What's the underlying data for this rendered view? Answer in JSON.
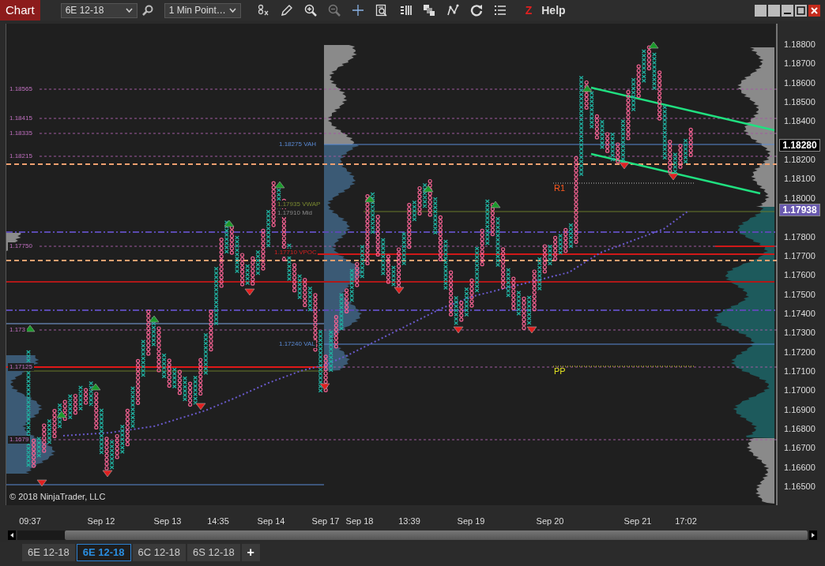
{
  "toolbar": {
    "app_button": "Chart",
    "instrument": "6E 12-18",
    "interval": "1 Min Point…",
    "badge": "Z",
    "help": "Help"
  },
  "price_axis": {
    "labels": [
      "1.18800",
      "1.18700",
      "1.18600",
      "1.18500",
      "1.18400",
      "1.18200",
      "1.18100",
      "1.18000",
      "1.17800",
      "1.17700",
      "1.17600",
      "1.17500",
      "1.17400",
      "1.17300",
      "1.17200",
      "1.17100",
      "1.17000",
      "1.16900",
      "1.16800",
      "1.16700",
      "1.16600",
      "1.16500"
    ],
    "markers": [
      {
        "text": "1.18280",
        "kind": "last"
      },
      {
        "text": "1.17938",
        "kind": "vwap"
      }
    ]
  },
  "level_labels": [
    "1.18565",
    "1.18415",
    "1.18335",
    "1.18215",
    "1.17750",
    "1.173",
    "1.17125",
    "1.1679"
  ],
  "study_labels": [
    {
      "text": "1.18275 VAH",
      "kind": "value-area"
    },
    {
      "text": "1.17935 VWAP",
      "kind": "vwap"
    },
    {
      "text": "1.17910 Mid",
      "kind": "mid"
    },
    {
      "text": "1.17710 VPOC",
      "kind": "poc"
    },
    {
      "text": "1.17240 VAL",
      "kind": "value-area"
    }
  ],
  "pivot_labels": [
    {
      "text": "R1",
      "kind": "resistance"
    },
    {
      "text": "PP",
      "kind": "pivot"
    }
  ],
  "copyright": "© 2018 NinjaTrader, LLC",
  "time_axis": [
    "09:37",
    "Sep 12",
    "Sep 13",
    "14:35",
    "Sep 14",
    "Sep 17",
    "Sep 18",
    "13:39",
    "Sep 19",
    "Sep 20",
    "Sep 21",
    "17:02"
  ],
  "tabs": [
    {
      "label": "6E 12-18",
      "selected": false
    },
    {
      "label": "6E 12-18",
      "selected": true
    },
    {
      "label": "6C 12-18",
      "selected": false
    },
    {
      "label": "6S 12-18",
      "selected": false
    }
  ],
  "add_tab": "+"
}
